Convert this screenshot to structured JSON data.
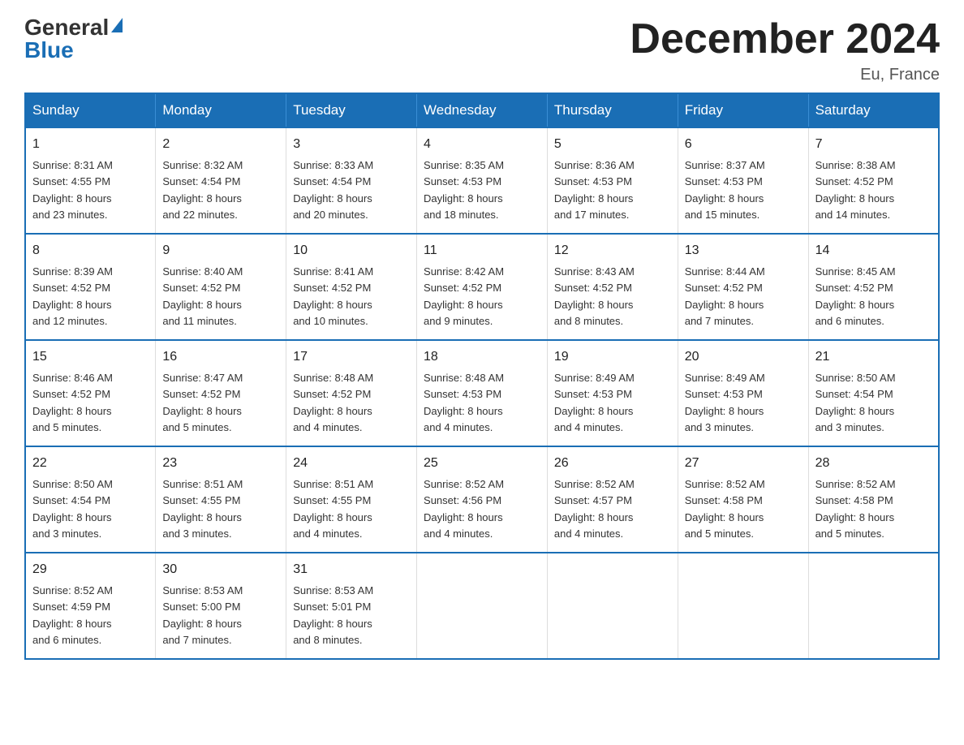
{
  "header": {
    "logo_general": "General",
    "logo_blue": "Blue",
    "title": "December 2024",
    "location": "Eu, France"
  },
  "days_of_week": [
    "Sunday",
    "Monday",
    "Tuesday",
    "Wednesday",
    "Thursday",
    "Friday",
    "Saturday"
  ],
  "weeks": [
    [
      {
        "day": "1",
        "sunrise": "8:31 AM",
        "sunset": "4:55 PM",
        "daylight": "8 hours and 23 minutes."
      },
      {
        "day": "2",
        "sunrise": "8:32 AM",
        "sunset": "4:54 PM",
        "daylight": "8 hours and 22 minutes."
      },
      {
        "day": "3",
        "sunrise": "8:33 AM",
        "sunset": "4:54 PM",
        "daylight": "8 hours and 20 minutes."
      },
      {
        "day": "4",
        "sunrise": "8:35 AM",
        "sunset": "4:53 PM",
        "daylight": "8 hours and 18 minutes."
      },
      {
        "day": "5",
        "sunrise": "8:36 AM",
        "sunset": "4:53 PM",
        "daylight": "8 hours and 17 minutes."
      },
      {
        "day": "6",
        "sunrise": "8:37 AM",
        "sunset": "4:53 PM",
        "daylight": "8 hours and 15 minutes."
      },
      {
        "day": "7",
        "sunrise": "8:38 AM",
        "sunset": "4:52 PM",
        "daylight": "8 hours and 14 minutes."
      }
    ],
    [
      {
        "day": "8",
        "sunrise": "8:39 AM",
        "sunset": "4:52 PM",
        "daylight": "8 hours and 12 minutes."
      },
      {
        "day": "9",
        "sunrise": "8:40 AM",
        "sunset": "4:52 PM",
        "daylight": "8 hours and 11 minutes."
      },
      {
        "day": "10",
        "sunrise": "8:41 AM",
        "sunset": "4:52 PM",
        "daylight": "8 hours and 10 minutes."
      },
      {
        "day": "11",
        "sunrise": "8:42 AM",
        "sunset": "4:52 PM",
        "daylight": "8 hours and 9 minutes."
      },
      {
        "day": "12",
        "sunrise": "8:43 AM",
        "sunset": "4:52 PM",
        "daylight": "8 hours and 8 minutes."
      },
      {
        "day": "13",
        "sunrise": "8:44 AM",
        "sunset": "4:52 PM",
        "daylight": "8 hours and 7 minutes."
      },
      {
        "day": "14",
        "sunrise": "8:45 AM",
        "sunset": "4:52 PM",
        "daylight": "8 hours and 6 minutes."
      }
    ],
    [
      {
        "day": "15",
        "sunrise": "8:46 AM",
        "sunset": "4:52 PM",
        "daylight": "8 hours and 5 minutes."
      },
      {
        "day": "16",
        "sunrise": "8:47 AM",
        "sunset": "4:52 PM",
        "daylight": "8 hours and 5 minutes."
      },
      {
        "day": "17",
        "sunrise": "8:48 AM",
        "sunset": "4:52 PM",
        "daylight": "8 hours and 4 minutes."
      },
      {
        "day": "18",
        "sunrise": "8:48 AM",
        "sunset": "4:53 PM",
        "daylight": "8 hours and 4 minutes."
      },
      {
        "day": "19",
        "sunrise": "8:49 AM",
        "sunset": "4:53 PM",
        "daylight": "8 hours and 4 minutes."
      },
      {
        "day": "20",
        "sunrise": "8:49 AM",
        "sunset": "4:53 PM",
        "daylight": "8 hours and 3 minutes."
      },
      {
        "day": "21",
        "sunrise": "8:50 AM",
        "sunset": "4:54 PM",
        "daylight": "8 hours and 3 minutes."
      }
    ],
    [
      {
        "day": "22",
        "sunrise": "8:50 AM",
        "sunset": "4:54 PM",
        "daylight": "8 hours and 3 minutes."
      },
      {
        "day": "23",
        "sunrise": "8:51 AM",
        "sunset": "4:55 PM",
        "daylight": "8 hours and 3 minutes."
      },
      {
        "day": "24",
        "sunrise": "8:51 AM",
        "sunset": "4:55 PM",
        "daylight": "8 hours and 4 minutes."
      },
      {
        "day": "25",
        "sunrise": "8:52 AM",
        "sunset": "4:56 PM",
        "daylight": "8 hours and 4 minutes."
      },
      {
        "day": "26",
        "sunrise": "8:52 AM",
        "sunset": "4:57 PM",
        "daylight": "8 hours and 4 minutes."
      },
      {
        "day": "27",
        "sunrise": "8:52 AM",
        "sunset": "4:58 PM",
        "daylight": "8 hours and 5 minutes."
      },
      {
        "day": "28",
        "sunrise": "8:52 AM",
        "sunset": "4:58 PM",
        "daylight": "8 hours and 5 minutes."
      }
    ],
    [
      {
        "day": "29",
        "sunrise": "8:52 AM",
        "sunset": "4:59 PM",
        "daylight": "8 hours and 6 minutes."
      },
      {
        "day": "30",
        "sunrise": "8:53 AM",
        "sunset": "5:00 PM",
        "daylight": "8 hours and 7 minutes."
      },
      {
        "day": "31",
        "sunrise": "8:53 AM",
        "sunset": "5:01 PM",
        "daylight": "8 hours and 8 minutes."
      },
      null,
      null,
      null,
      null
    ]
  ],
  "labels": {
    "sunrise": "Sunrise:",
    "sunset": "Sunset:",
    "daylight": "Daylight:"
  }
}
